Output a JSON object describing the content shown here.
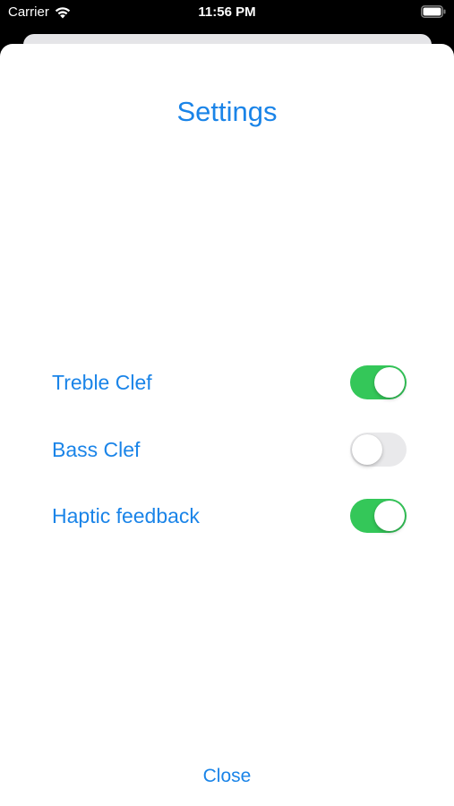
{
  "status_bar": {
    "carrier": "Carrier",
    "time": "11:56 PM",
    "wifi_icon": "wifi-icon",
    "battery_icon": "battery-icon"
  },
  "sheet": {
    "title": "Settings",
    "settings": [
      {
        "label": "Treble Clef",
        "enabled": true
      },
      {
        "label": "Bass Clef",
        "enabled": false
      },
      {
        "label": "Haptic feedback",
        "enabled": true
      }
    ],
    "close_label": "Close"
  },
  "colors": {
    "accent": "#1a84e8",
    "toggle_on": "#34c759",
    "toggle_off": "#e9e9eb"
  }
}
